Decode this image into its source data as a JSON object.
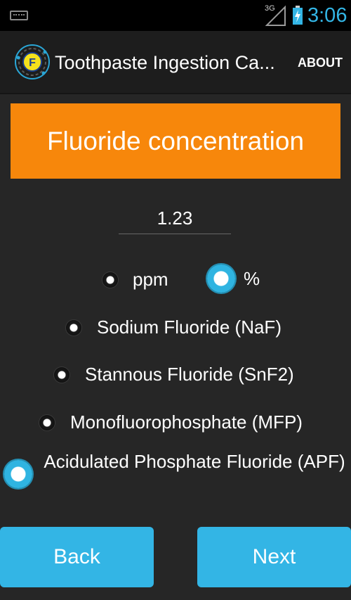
{
  "status_bar": {
    "network_label": "3G",
    "time": "3:06",
    "icons": [
      "keyboard-icon",
      "signal-icon",
      "battery-charging-icon"
    ],
    "accent_color": "#33b5e5"
  },
  "action_bar": {
    "title": "Toothpaste Ingestion Ca...",
    "logo_letter": "F",
    "about_label": "ABOUT"
  },
  "section": {
    "title": "Fluoride concentration",
    "banner_color": "#f7870b"
  },
  "concentration_input": {
    "value": "1.23"
  },
  "units": {
    "options": [
      {
        "label": "ppm",
        "checked": false
      },
      {
        "label": "%",
        "checked": true
      }
    ]
  },
  "compounds": {
    "options": [
      {
        "label": "Sodium Fluoride (NaF)",
        "checked": false
      },
      {
        "label": "Stannous Fluoride (SnF2)",
        "checked": false
      },
      {
        "label": "Monofluorophosphate (MFP)",
        "checked": false
      },
      {
        "label": "Acidulated Phosphate Fluoride (APF)",
        "checked": true
      }
    ]
  },
  "navigation": {
    "back_label": "Back",
    "next_label": "Next",
    "button_color": "#33b5e5"
  }
}
